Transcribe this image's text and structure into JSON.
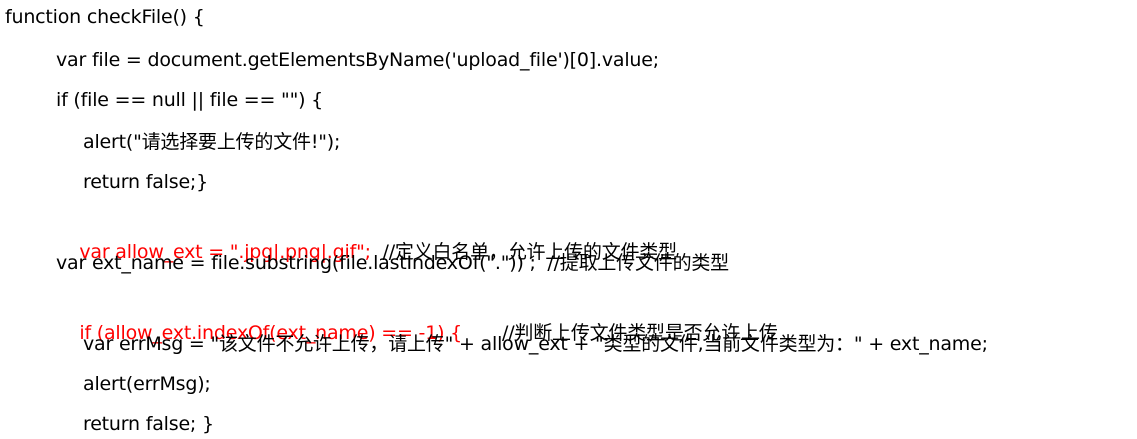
{
  "colors": {
    "highlight": "#ff0000",
    "text": "#000000",
    "background": "#ffffff"
  },
  "code": {
    "line1": "function checkFile() {",
    "line2": "var file = document.getElementsByName('upload_file')[0].value;",
    "line3": "if (file == null || file == \"\") {",
    "line4": "alert(\"请选择要上传的文件!\");",
    "line5": "return false;}",
    "line6_code": "var allow_ext = \".jpg|.png|.gif\";",
    "line6_comment": "  //定义白名单，允许上传的文件类型",
    "line7": "var ext_name = file.substring(file.lastIndexOf(\".\")) ;  //提取上传文件的类型",
    "line8_code": "if (allow_ext.indexOf(ext_name) == -1) {",
    "line8_comment": "//判断上传文件类型是否允许上传",
    "line9": "var errMsg = \"该文件不允许上传，请上传\" + allow_ext + \"类型的文件,当前文件类型为：\" + ext_name;",
    "line10": "alert(errMsg);",
    "line11": "return false; }"
  }
}
